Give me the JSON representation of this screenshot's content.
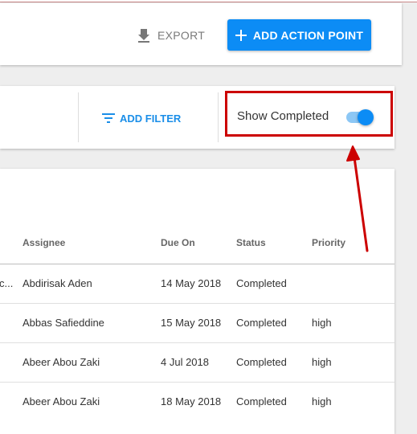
{
  "header": {
    "export_label": "EXPORT",
    "add_label": "ADD ACTION POINT"
  },
  "filters": {
    "add_filter_label": "ADD FILTER",
    "show_completed_label": "Show Completed",
    "show_completed_on": true
  },
  "table": {
    "columns": [
      "Assignee",
      "Due On",
      "Status",
      "Priority"
    ],
    "rows": [
      {
        "truncated": "c...",
        "assignee": "Abdirisak Aden",
        "due_on": "14 May 2018",
        "status": "Completed",
        "priority": ""
      },
      {
        "truncated": "",
        "assignee": "Abbas Safieddine",
        "due_on": "15 May 2018",
        "status": "Completed",
        "priority": "high"
      },
      {
        "truncated": "",
        "assignee": "Abeer Abou Zaki",
        "due_on": "4 Jul 2018",
        "status": "Completed",
        "priority": "high"
      },
      {
        "truncated": "",
        "assignee": "Abeer Abou Zaki",
        "due_on": "18 May 2018",
        "status": "Completed",
        "priority": "high"
      }
    ]
  },
  "colors": {
    "accent": "#0c8cf5",
    "highlight": "#cc0000"
  }
}
